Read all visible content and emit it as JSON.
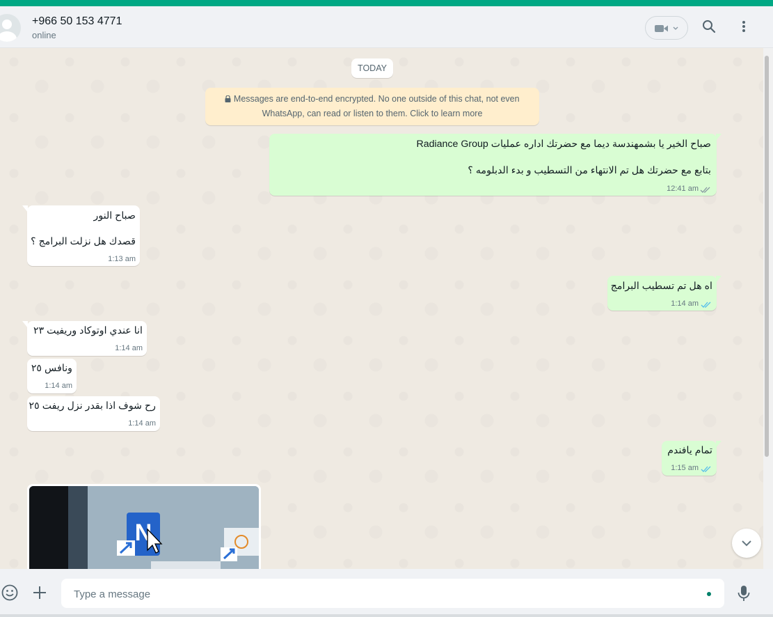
{
  "header": {
    "contact_name": "+966 50 153 4771",
    "status": "online",
    "icons": [
      "video-call-icon",
      "chevron-down-icon",
      "search-icon",
      "menu-dots-icon"
    ]
  },
  "chat": {
    "date_label": "TODAY",
    "encryption_notice_line1": "Messages are end-to-end encrypted. No one outside of this chat, not even",
    "encryption_notice_line2": "WhatsApp, can read or listen to them. Click to learn more",
    "messages": [
      {
        "direction": "outgoing",
        "lines": [
          "صباح الخير يا بشمهندسة ديما مع  حضرتك اداره عمليات Radiance Group",
          "بتابع مع حضرتك هل تم الانتهاء من التسطيب و بدء الدبلومه ؟"
        ],
        "time": "12:41 am",
        "status": "read"
      },
      {
        "direction": "incoming",
        "lines": [
          "صباح النور",
          "قصدك هل نزلت البرامج ؟"
        ],
        "time": "1:13 am"
      },
      {
        "direction": "outgoing",
        "lines": [
          "اه هل تم تسطيب البرامج"
        ],
        "time": "1:14 am",
        "status": "read"
      },
      {
        "direction": "incoming",
        "lines": [
          "انا عندي اوتوكاد وريفيت ٢٣"
        ],
        "time": "1:14 am"
      },
      {
        "direction": "incoming",
        "lines": [
          "ونافس ٢٥"
        ],
        "time": "1:14 am"
      },
      {
        "direction": "incoming",
        "lines": [
          "رح شوف اذا بقدر نزل ريفت ٢٥"
        ],
        "time": "1:14 am"
      },
      {
        "direction": "outgoing",
        "lines": [
          "تمام يافندم"
        ],
        "time": "1:15 am",
        "status": "read"
      }
    ],
    "image_message_icon_letter": "N"
  },
  "composer": {
    "placeholder": "Type a message",
    "icons": [
      "emoji-icon",
      "attach-plus-icon",
      "microphone-icon"
    ]
  },
  "colors": {
    "accent": "#00a884",
    "outgoing_bubble": "#d9fdd3",
    "incoming_bubble": "#ffffff",
    "read_ticks": "#53bdeb",
    "encryption_bg": "#ffeecd"
  }
}
